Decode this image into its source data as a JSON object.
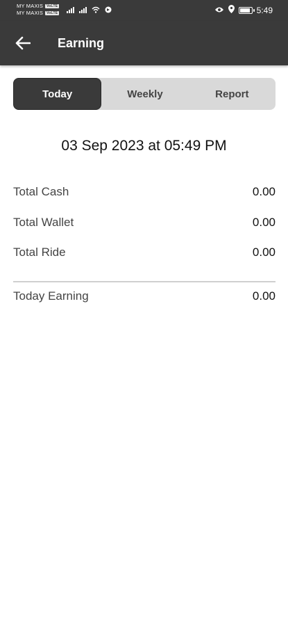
{
  "status_bar": {
    "carrier_1": "MY MAXIS",
    "carrier_2": "MY MAXIS",
    "volte_1": "VoLTE",
    "volte_2": "VoLTE",
    "time": "5:49",
    "battery_level": 0.9
  },
  "app_bar": {
    "title": "Earning",
    "back_icon": "arrow-left-icon"
  },
  "tabs": [
    {
      "label": "Today",
      "active": true
    },
    {
      "label": "Weekly",
      "active": false
    },
    {
      "label": "Report",
      "active": false
    }
  ],
  "datetime": "03 Sep 2023 at 05:49 PM",
  "summary": {
    "total_cash_label": "Total Cash",
    "total_cash_value": "0.00",
    "total_wallet_label": "Total Wallet",
    "total_wallet_value": "0.00",
    "total_ride_label": "Total Ride",
    "total_ride_value": "0.00",
    "today_earning_label": "Today Earning",
    "today_earning_value": "0.00"
  },
  "colors": {
    "header_bg": "#3a3a3a",
    "tab_bg": "#d9d9d9",
    "tab_active_bg": "#3a3a3a"
  }
}
